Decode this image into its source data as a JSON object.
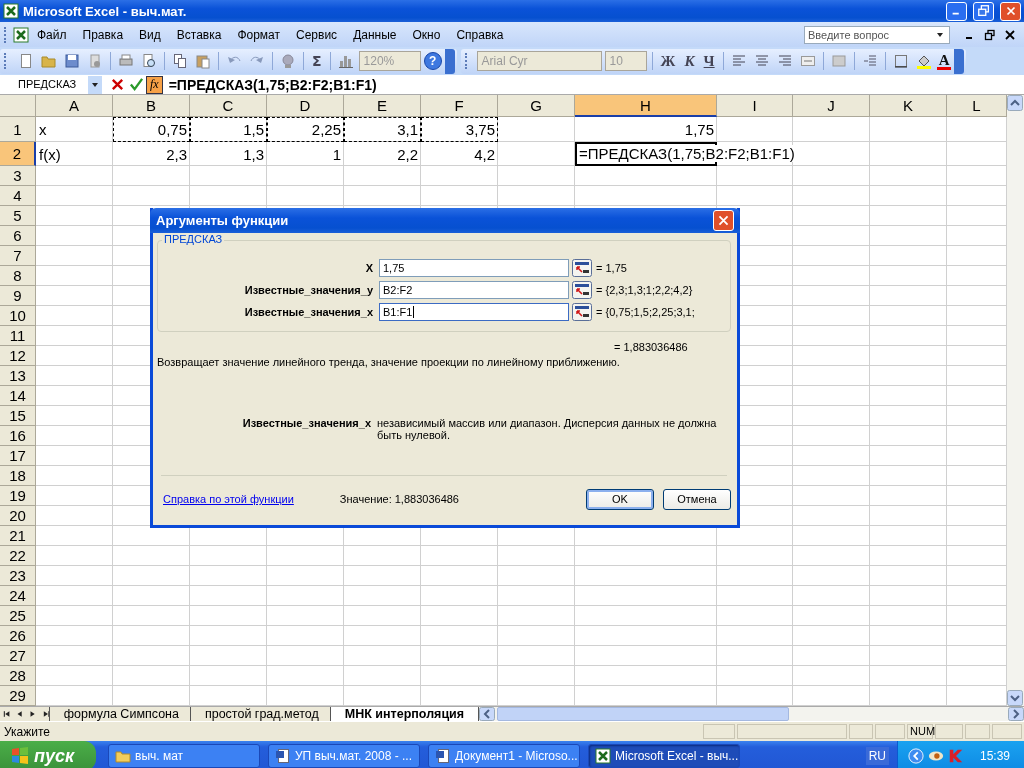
{
  "window": {
    "title": "Microsoft Excel - выч.мат."
  },
  "menu": [
    "Файл",
    "Правка",
    "Вид",
    "Вставка",
    "Формат",
    "Сервис",
    "Данные",
    "Окно",
    "Справка"
  ],
  "help_search": {
    "placeholder": "Введите вопрос"
  },
  "standard_toolbar": {
    "autosum": "Σ",
    "zoom": "120%",
    "help": "?"
  },
  "formatting_toolbar": {
    "font": "Arial Cyr",
    "font_size": "10",
    "bold": "Ж",
    "italic": "К",
    "underline": "Ч",
    "font_color": "A"
  },
  "formula_bar": {
    "name_box": "ПРЕДСКАЗ",
    "fx": "fx",
    "formula": "=ПРЕДСКАЗ(1,75;B2:F2;B1:F1)"
  },
  "sheet": {
    "columns": [
      {
        "label": "A",
        "selected": false
      },
      {
        "label": "B",
        "selected": false
      },
      {
        "label": "C",
        "selected": false
      },
      {
        "label": "D",
        "selected": false
      },
      {
        "label": "E",
        "selected": false
      },
      {
        "label": "F",
        "selected": false
      },
      {
        "label": "G",
        "selected": false
      },
      {
        "label": "H",
        "selected": true
      },
      {
        "label": "I",
        "selected": false
      },
      {
        "label": "J",
        "selected": false
      },
      {
        "label": "K",
        "selected": false
      },
      {
        "label": "L",
        "selected": false
      }
    ],
    "rows": [
      {
        "label": "1",
        "selected": false,
        "cells": [
          {
            "kind": "text",
            "text": "x",
            "referenced": false
          },
          {
            "kind": "number",
            "text": "0,75",
            "referenced": true
          },
          {
            "kind": "number",
            "text": "1,5",
            "referenced": true
          },
          {
            "kind": "number",
            "text": "2,25",
            "referenced": true
          },
          {
            "kind": "number",
            "text": "3,1",
            "referenced": true
          },
          {
            "kind": "number",
            "text": "3,75",
            "referenced": true
          },
          {
            "kind": "empty",
            "referenced": false
          },
          {
            "kind": "number",
            "text": "1,75",
            "referenced": false
          },
          {
            "kind": "empty",
            "referenced": false
          },
          {
            "kind": "empty",
            "referenced": false
          },
          {
            "kind": "empty",
            "referenced": false
          },
          {
            "kind": "empty",
            "referenced": false
          }
        ]
      },
      {
        "label": "2",
        "selected": true,
        "cells": [
          {
            "kind": "text",
            "text": "f(x)",
            "referenced": false
          },
          {
            "kind": "number",
            "text": "2,3",
            "referenced": false
          },
          {
            "kind": "number",
            "text": "1,3",
            "referenced": false
          },
          {
            "kind": "number",
            "text": "1",
            "referenced": false
          },
          {
            "kind": "number",
            "text": "2,2",
            "referenced": false
          },
          {
            "kind": "number",
            "text": "4,2",
            "referenced": false
          },
          {
            "kind": "empty",
            "referenced": false
          },
          {
            "kind": "editing",
            "text": "=ПРЕДСКАЗ(1,75;B2:F2;B1:F1)",
            "referenced": false
          },
          {
            "kind": "empty",
            "referenced": false
          },
          {
            "kind": "empty",
            "referenced": false
          },
          {
            "kind": "empty",
            "referenced": false
          },
          {
            "kind": "empty",
            "referenced": false
          }
        ]
      },
      {
        "label": "3",
        "selected": false
      },
      {
        "label": "4",
        "selected": false
      },
      {
        "label": "5",
        "selected": false
      },
      {
        "label": "6",
        "selected": false
      },
      {
        "label": "7",
        "selected": false
      },
      {
        "label": "8",
        "selected": false
      },
      {
        "label": "9",
        "selected": false
      },
      {
        "label": "10",
        "selected": false
      },
      {
        "label": "11",
        "selected": false
      },
      {
        "label": "12",
        "selected": false
      },
      {
        "label": "13",
        "selected": false
      },
      {
        "label": "14",
        "selected": false
      },
      {
        "label": "15",
        "selected": false
      },
      {
        "label": "16",
        "selected": false
      },
      {
        "label": "17",
        "selected": false
      },
      {
        "label": "18",
        "selected": false
      },
      {
        "label": "19",
        "selected": false
      },
      {
        "label": "20",
        "selected": false
      },
      {
        "label": "21",
        "selected": false
      },
      {
        "label": "22",
        "selected": false
      },
      {
        "label": "23",
        "selected": false
      },
      {
        "label": "24",
        "selected": false
      },
      {
        "label": "25",
        "selected": false
      },
      {
        "label": "26",
        "selected": false
      },
      {
        "label": "27",
        "selected": false
      },
      {
        "label": "28",
        "selected": false
      },
      {
        "label": "29",
        "selected": false
      }
    ]
  },
  "dialog": {
    "title": "Аргументы функции",
    "function": "ПРЕДСКАЗ",
    "arguments": [
      {
        "label": "X",
        "value": "1,75",
        "result": "= 1,75",
        "focused": false
      },
      {
        "label": "Известные_значения_y",
        "value": "B2:F2",
        "result": "= {2,3;1,3;1;2,2;4,2}",
        "focused": false
      },
      {
        "label": "Известные_значения_x",
        "value": "B1:F1",
        "result": "= {0,75;1,5;2,25;3,1;",
        "focused": true
      }
    ],
    "result": "= 1,883036486",
    "description": "Возвращает значение линейного тренда, значение проекции по линейному приближению.",
    "argument_help": {
      "label": "Известные_значения_x",
      "text": "независимый массив или диапазон. Дисперсия данных не должна быть нулевой."
    },
    "help_link": "Справка по этой функции",
    "value": "Значение: 1,883036486",
    "buttons": [
      {
        "label": "OK",
        "default": true
      },
      {
        "label": "Отмена",
        "default": false
      }
    ]
  },
  "sheet_tabs": [
    {
      "label": "формула Симпсона",
      "selected": false
    },
    {
      "label": "простой град.метод",
      "selected": false
    },
    {
      "label": "МНК интерполяция",
      "selected": true
    }
  ],
  "status_bar": {
    "text": "Укажите",
    "indicator": "NUM"
  },
  "taskbar": {
    "start": "пуск",
    "tasks": [
      {
        "label": "выч. мат",
        "kind": "folder",
        "selected": false
      },
      {
        "label": "УП выч.мат. 2008 - ...",
        "kind": "word",
        "selected": false
      },
      {
        "label": "Документ1 - Microso...",
        "kind": "word",
        "selected": false
      },
      {
        "label": "Microsoft Excel - выч...",
        "kind": "excel",
        "selected": true
      }
    ],
    "language": "RU",
    "clock": "15:39"
  }
}
